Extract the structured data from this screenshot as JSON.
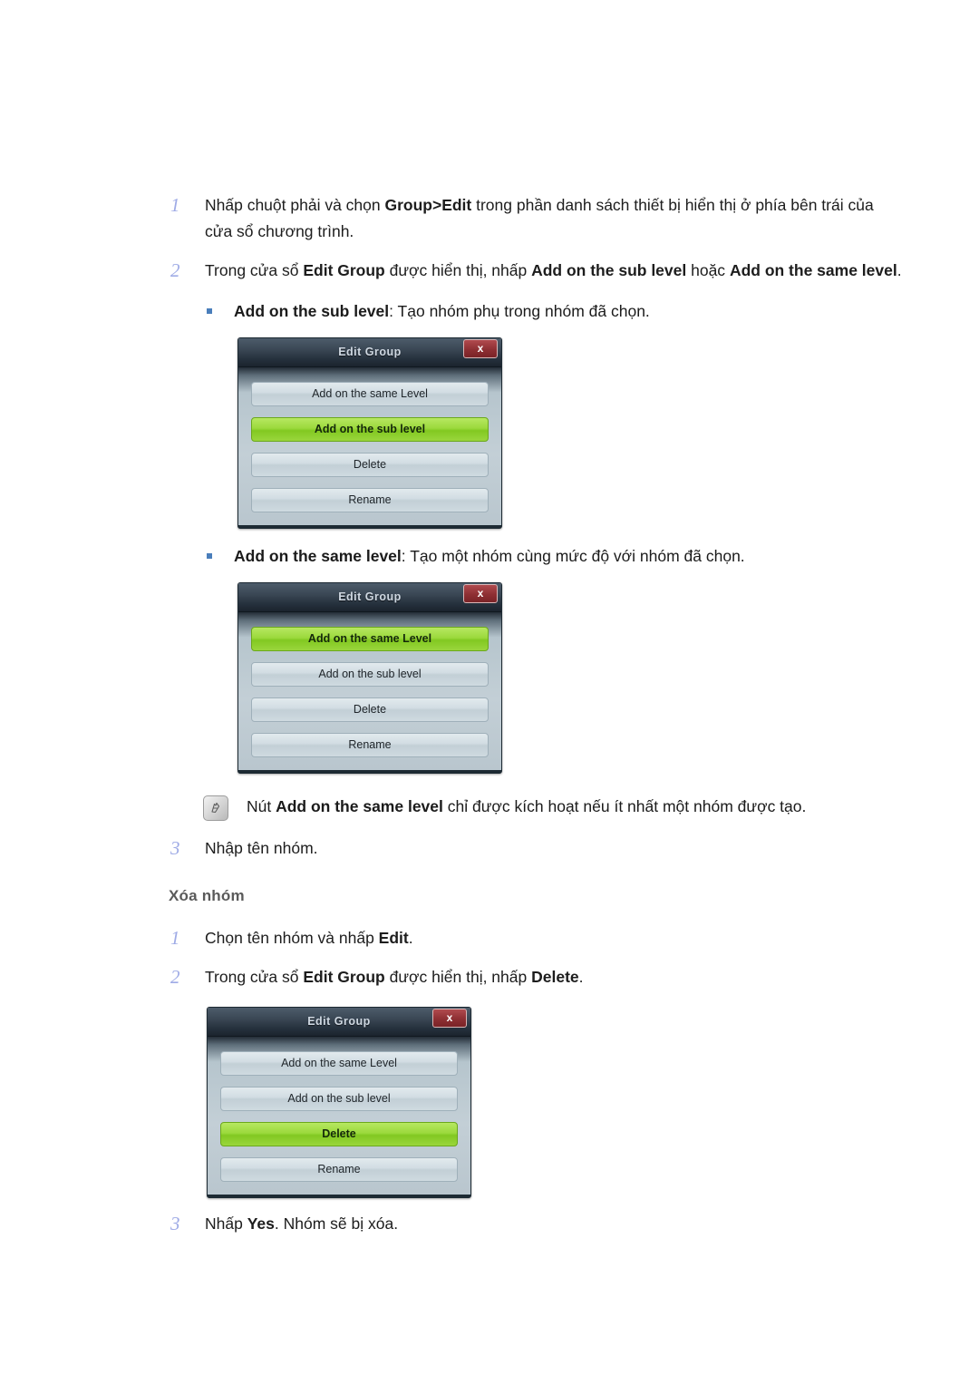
{
  "steps_top": [
    {
      "num": "1",
      "segments": [
        {
          "t": "Nhấp chuột phải và chọn ",
          "b": false
        },
        {
          "t": "Group>Edit",
          "b": true
        },
        {
          "t": " trong phần danh sách thiết bị hiển thị ở phía bên trái của cửa sổ chương trình.",
          "b": false
        }
      ]
    },
    {
      "num": "2",
      "segments": [
        {
          "t": "Trong cửa sổ ",
          "b": false
        },
        {
          "t": "Edit Group",
          "b": true
        },
        {
          "t": " được hiển thị, nhấp ",
          "b": false
        },
        {
          "t": "Add on the sub level",
          "b": true
        },
        {
          "t": " hoặc ",
          "b": false
        },
        {
          "t": "Add on the same level",
          "b": true
        },
        {
          "t": ".",
          "b": false
        }
      ]
    }
  ],
  "bullet_sub": {
    "marker": "square-bullet",
    "segments": [
      {
        "t": "Add on the sub level",
        "b": true
      },
      {
        "t": ": Tạo nhóm phụ trong nhóm đã chọn.",
        "b": false
      }
    ]
  },
  "bullet_same": {
    "marker": "square-bullet",
    "segments": [
      {
        "t": "Add on the same level",
        "b": true
      },
      {
        "t": ": Tạo một nhóm cùng mức độ với nhóm đã chọn.",
        "b": false
      }
    ]
  },
  "note": {
    "icon": "note-pencil-icon",
    "segments": [
      {
        "t": "Nút ",
        "b": false
      },
      {
        "t": "Add on the same level",
        "b": true
      },
      {
        "t": " chỉ được kích hoạt nếu ít nhất một nhóm được tạo.",
        "b": false
      }
    ]
  },
  "step_3_top": {
    "num": "3",
    "segments": [
      {
        "t": "Nhập tên nhóm.",
        "b": false
      }
    ]
  },
  "section_heading": "Xóa nhóm",
  "steps_bottom": [
    {
      "num": "1",
      "segments": [
        {
          "t": "Chọn tên nhóm và nhấp ",
          "b": false
        },
        {
          "t": "Edit",
          "b": true
        },
        {
          "t": ".",
          "b": false
        }
      ]
    },
    {
      "num": "2",
      "segments": [
        {
          "t": "Trong cửa sổ ",
          "b": false
        },
        {
          "t": "Edit Group",
          "b": true
        },
        {
          "t": " được hiển thị, nhấp ",
          "b": false
        },
        {
          "t": "Delete",
          "b": true
        },
        {
          "t": ".",
          "b": false
        }
      ]
    }
  ],
  "step_3_bottom": {
    "num": "3",
    "segments": [
      {
        "t": "Nhấp ",
        "b": false
      },
      {
        "t": "Yes",
        "b": true
      },
      {
        "t": ". Nhóm sẽ bị xóa.",
        "b": false
      }
    ]
  },
  "dialogs": [
    {
      "title": "Edit Group",
      "close_label": "x",
      "buttons": [
        {
          "label": "Add on the same Level",
          "highlighted": false
        },
        {
          "label": "Add on the sub level",
          "highlighted": true
        },
        {
          "label": "Delete",
          "highlighted": false
        },
        {
          "label": "Rename",
          "highlighted": false
        }
      ]
    },
    {
      "title": "Edit Group",
      "close_label": "x",
      "buttons": [
        {
          "label": "Add on the same Level",
          "highlighted": true
        },
        {
          "label": "Add on the sub level",
          "highlighted": false
        },
        {
          "label": "Delete",
          "highlighted": false
        },
        {
          "label": "Rename",
          "highlighted": false
        }
      ]
    },
    {
      "title": "Edit Group",
      "close_label": "x",
      "buttons": [
        {
          "label": "Add on the same Level",
          "highlighted": false
        },
        {
          "label": "Add on the sub level",
          "highlighted": false
        },
        {
          "label": "Delete",
          "highlighted": true
        },
        {
          "label": "Rename",
          "highlighted": false
        }
      ]
    }
  ],
  "colors": {
    "step_number": "#9fabe6",
    "bullet": "#4a7ebb",
    "heading": "#5a5a5a",
    "dialog_green": "#9bd93c",
    "dialog_close_red": "#8e2f33",
    "dialog_titlebar": "#3a4754"
  }
}
